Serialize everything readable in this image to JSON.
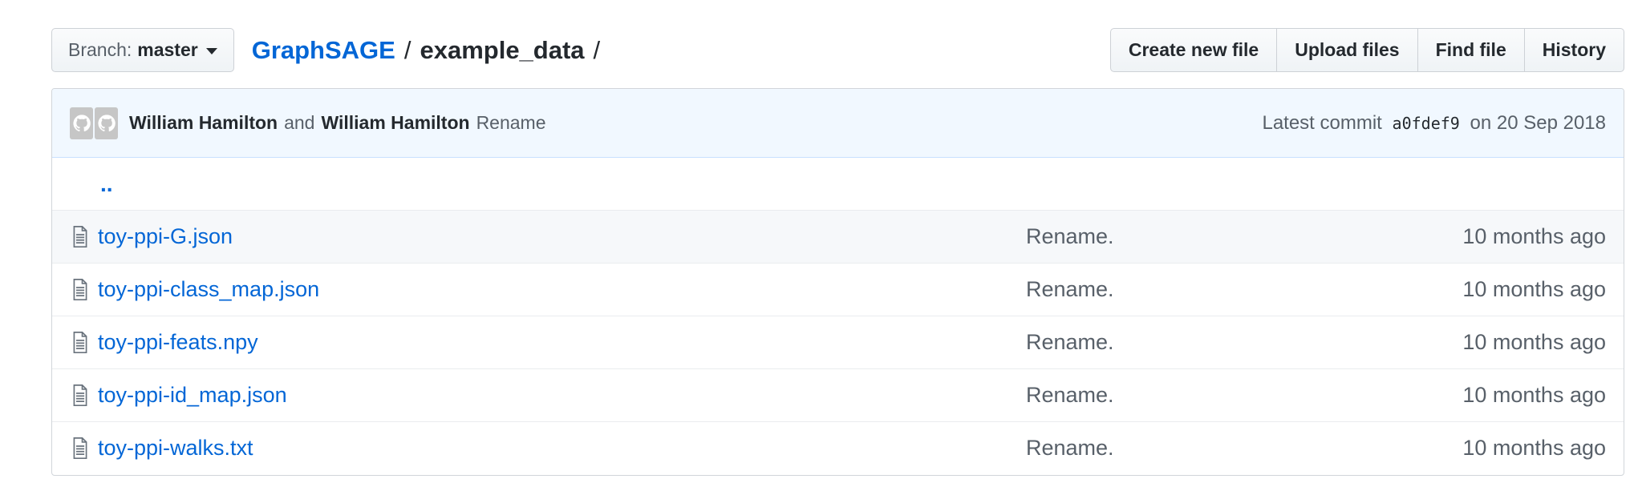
{
  "branch": {
    "prefix": "Branch:",
    "name": "master"
  },
  "breadcrumb": {
    "repo": "GraphSAGE",
    "sep1": "/",
    "folder": "example_data",
    "sep2": "/"
  },
  "toolbar": {
    "create_label": "Create new file",
    "upload_label": "Upload files",
    "find_label": "Find file",
    "history_label": "History"
  },
  "commit": {
    "author1": "William Hamilton",
    "joiner": "and",
    "author2": "William Hamilton",
    "message": "Rename",
    "latest_prefix": "Latest commit",
    "sha": "a0fdef9",
    "date": "on 20 Sep 2018"
  },
  "up_dir": "..",
  "files": [
    {
      "name": "toy-ppi-G.json",
      "message": "Rename.",
      "age": "10 months ago",
      "icon": "file-text-icon"
    },
    {
      "name": "toy-ppi-class_map.json",
      "message": "Rename.",
      "age": "10 months ago",
      "icon": "file-text-icon"
    },
    {
      "name": "toy-ppi-feats.npy",
      "message": "Rename.",
      "age": "10 months ago",
      "icon": "file-text-icon"
    },
    {
      "name": "toy-ppi-id_map.json",
      "message": "Rename.",
      "age": "10 months ago",
      "icon": "file-text-icon"
    },
    {
      "name": "toy-ppi-walks.txt",
      "message": "Rename.",
      "age": "10 months ago",
      "icon": "file-text-icon"
    }
  ],
  "colors": {
    "link": "#0366d6",
    "commit_bg": "#f1f8ff",
    "muted": "#586069"
  }
}
